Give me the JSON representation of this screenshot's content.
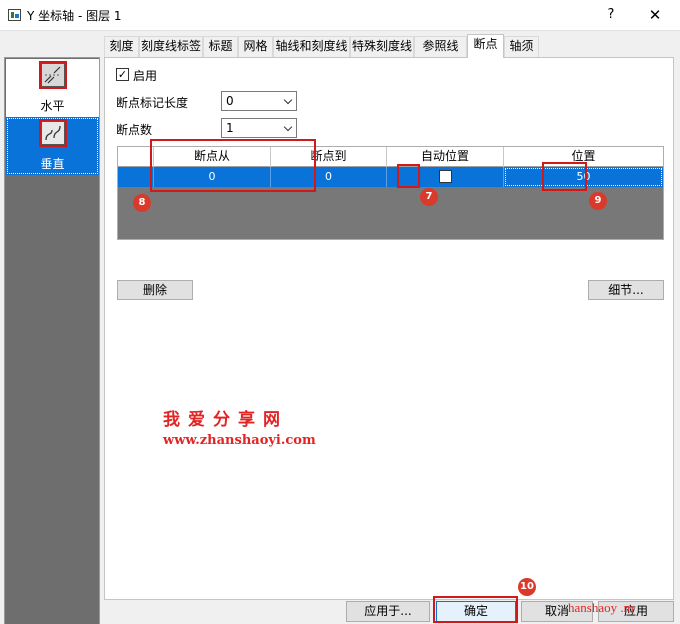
{
  "window": {
    "title": "Y 坐标轴 - 图层 1",
    "help": "?",
    "close": "✕"
  },
  "side_panel": {
    "items": [
      {
        "label": "水平"
      },
      {
        "label": "垂直"
      }
    ]
  },
  "tabs": [
    "刻度",
    "刻度线标签",
    "标题",
    "网格",
    "轴线和刻度线",
    "特殊刻度线",
    "参照线",
    "断点",
    "轴须"
  ],
  "active_tab": "断点",
  "enable": {
    "label": "启用",
    "checked": true,
    "mark": "✓"
  },
  "break_length": {
    "label": "断点标记长度",
    "value": "0"
  },
  "break_count": {
    "label": "断点数",
    "value": "1"
  },
  "grid": {
    "columns": [
      "断点从",
      "断点到",
      "自动位置",
      "位置"
    ],
    "rows": [
      {
        "from": "0",
        "to": "0",
        "auto_position": false,
        "position": "50"
      }
    ]
  },
  "buttons": {
    "delete": "删除",
    "details": "细节...",
    "apply_to": "应用于...",
    "ok": "确定",
    "cancel": "取消",
    "apply": "应用"
  },
  "callouts": {
    "b7": "7",
    "b8": "8",
    "b9": "9",
    "b10": "10"
  },
  "watermark": {
    "title": "我爱分享网",
    "url": "www.zhanshaoyi.com",
    "corner": "hanshaoy .m"
  },
  "colors": {
    "selection": "#0a73d9",
    "annotation": "#d21919",
    "badge": "#d93a2b",
    "grid_background": "#787878"
  }
}
